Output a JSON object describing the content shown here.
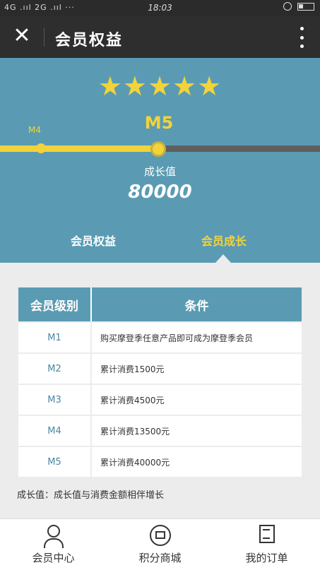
{
  "status_bar": {
    "signal": "4G .ııl 2G .ııl ···",
    "time": "18:03"
  },
  "header": {
    "title": "会员权益"
  },
  "hero": {
    "stars": "★★★★★",
    "current_level": "M5",
    "previous_level": "M4",
    "growth_label": "成长值",
    "growth_value": "80000",
    "tabs": [
      {
        "label": "会员权益",
        "active": false
      },
      {
        "label": "会员成长",
        "active": true
      }
    ],
    "accent_color": "#f2d33b",
    "bg_color": "#5a9bb3"
  },
  "table": {
    "headers": [
      "会员级别",
      "条件"
    ],
    "rows": [
      {
        "level": "M1",
        "condition": "购买摩登季任意产品即可成为摩登季会员"
      },
      {
        "level": "M2",
        "condition": "累计消费1500元"
      },
      {
        "level": "M3",
        "condition": "累计消费4500元"
      },
      {
        "level": "M4",
        "condition": "累计消费13500元"
      },
      {
        "level": "M5",
        "condition": "累计消费40000元"
      }
    ]
  },
  "note": "成长值：成长值与消费金额相伴增长",
  "bottom_nav": [
    {
      "label": "会员中心",
      "icon": "person-icon"
    },
    {
      "label": "积分商城",
      "icon": "shop-icon"
    },
    {
      "label": "我的订单",
      "icon": "order-icon"
    }
  ]
}
